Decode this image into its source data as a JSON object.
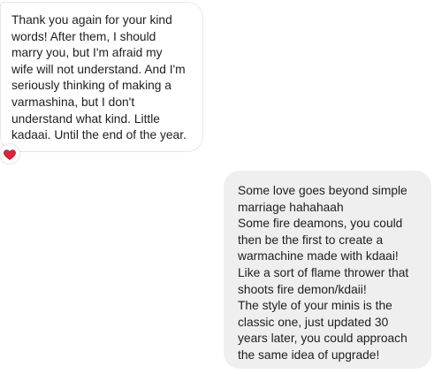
{
  "conversation": {
    "messages": [
      {
        "direction": "incoming",
        "text": "Thank you again for your kind\nwords! After them, I should\nmarry you, but I'm afraid my\nwife will not understand. And I'm\nseriously thinking of making a\nvarmashina, but I don't\nunderstand what kind. Little\nkadaai. Until the end of the year.",
        "reaction": "heart-icon"
      },
      {
        "direction": "outgoing",
        "text": "Some love goes beyond simple\nmarriage hahahaah\nSome fire deamons, you could\nthen be the first to create a\nwarmachine made with kdaai!\nLike a sort of flame thrower that\nshoots fire demon/kdaii!\nThe style of your minis is the\nclassic one, just updated 30\nyears later, you could approach\nthe same idea of upgrade!"
      }
    ]
  },
  "colors": {
    "incoming_bubble_bg": "#ffffff",
    "incoming_bubble_border": "#e8e8e8",
    "outgoing_bubble_bg": "#efefef",
    "text": "#1c1e21",
    "reaction_heart": "#e0243a"
  }
}
